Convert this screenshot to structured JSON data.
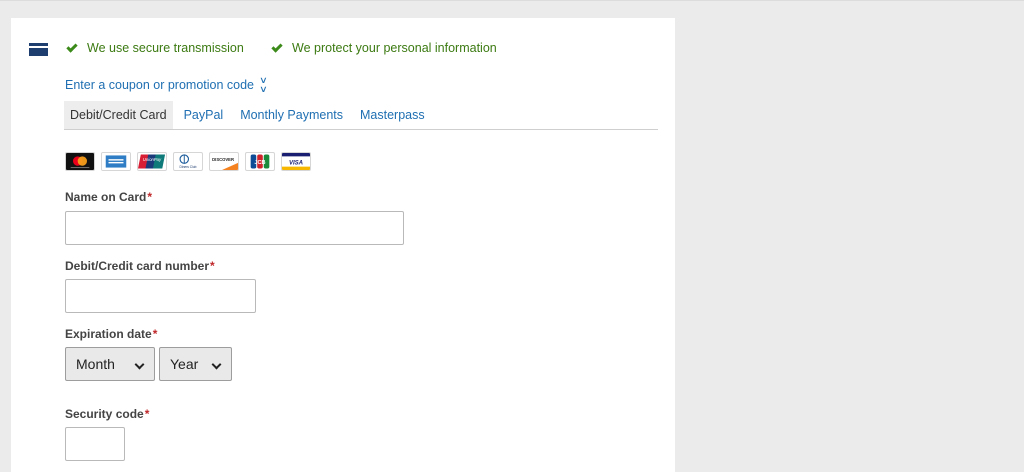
{
  "secure_messages": [
    "We use secure transmission",
    "We protect your personal information"
  ],
  "coupon_link": "Enter a coupon or promotion code",
  "payment_tabs": [
    {
      "label": "Debit/Credit Card",
      "active": true
    },
    {
      "label": "PayPal",
      "active": false
    },
    {
      "label": "Monthly Payments",
      "active": false
    },
    {
      "label": "Masterpass",
      "active": false
    }
  ],
  "card_logos": [
    {
      "icon": "mastercard-icon"
    },
    {
      "icon": "amex-icon"
    },
    {
      "icon": "unionpay-icon",
      "text": "UnionPay"
    },
    {
      "icon": "diners-club-icon",
      "text": "Diners Club"
    },
    {
      "icon": "discover-icon",
      "text": "DISCOVER"
    },
    {
      "icon": "jcb-icon",
      "text": "JCB"
    },
    {
      "icon": "visa-icon",
      "text": "VISA"
    }
  ],
  "form": {
    "name_label": "Name on Card",
    "name_value": "",
    "number_label": "Debit/Credit card number",
    "number_value": "",
    "expiration_label": "Expiration date",
    "month_selected": "Month",
    "year_selected": "Year",
    "security_label": "Security code",
    "security_value": "",
    "required_marker": "*"
  },
  "colors": {
    "brand_icon": "#1d3e6e",
    "secure_green": "#3c7a12",
    "link_blue": "#1f6fb2",
    "required_red": "#c0282b"
  }
}
